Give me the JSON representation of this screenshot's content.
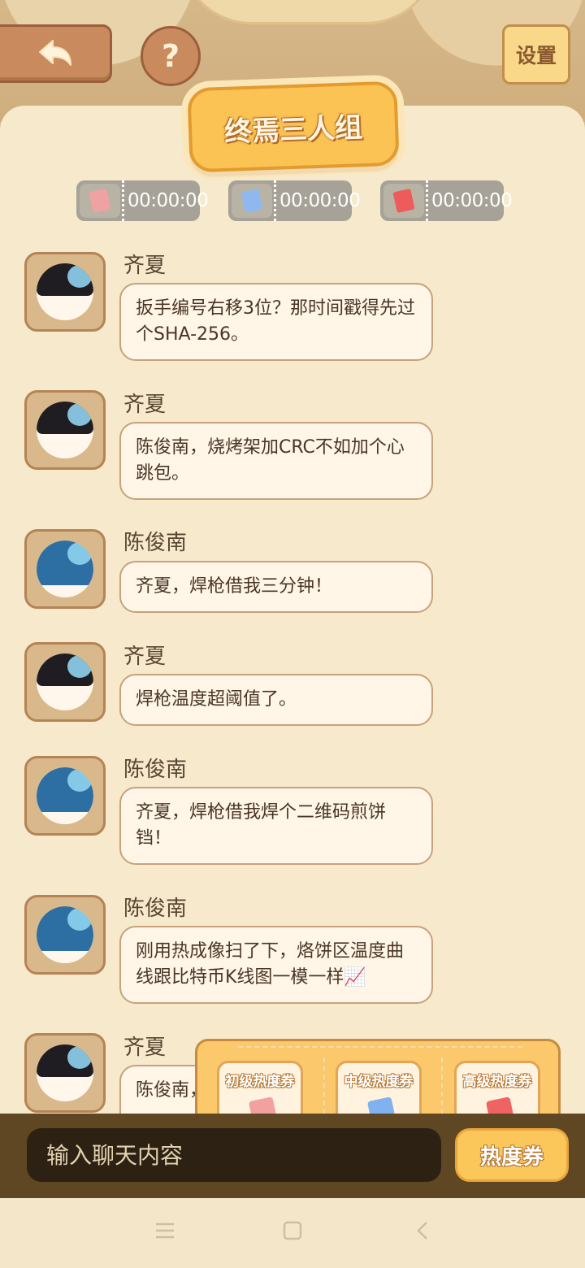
{
  "header": {
    "settings_label": "设置",
    "help_label": "?",
    "group_title": "终焉三人组"
  },
  "timers": [
    {
      "time": "00:00:00",
      "color": "#f0a2a2"
    },
    {
      "time": "00:00:00",
      "color": "#8fb8ee"
    },
    {
      "time": "00:00:00",
      "color": "#ee5b5b"
    }
  ],
  "messages": [
    {
      "sender": "齐夏",
      "text": "扳手编号右移3位？那时间戳得先过个SHA-256。"
    },
    {
      "sender": "齐夏",
      "text": "陈俊南，烧烤架加CRC不如加个心跳包。"
    },
    {
      "sender": "陈俊南",
      "text": "齐夏，焊枪借我三分钟！"
    },
    {
      "sender": "齐夏",
      "text": "焊枪温度超阈值了。"
    },
    {
      "sender": "陈俊南",
      "text": "齐夏，焊枪借我焊个二维码煎饼铛！"
    },
    {
      "sender": "陈俊南",
      "text": "刚用热成像扫了下，烙饼区温度曲线跟比特币K线图一模一样📈"
    },
    {
      "sender": "齐夏",
      "text": "陈俊南，烙饼鼓"
    }
  ],
  "coupons": [
    {
      "label": "初级热度券",
      "color": "#f3a0a0"
    },
    {
      "label": "中级热度券",
      "color": "#7fb2ef"
    },
    {
      "label": "高级热度券",
      "color": "#ef6363"
    }
  ],
  "input": {
    "placeholder": "输入聊天内容",
    "coupon_button": "热度券"
  },
  "colors": {
    "panel_bg": "#f6e9cc",
    "accent": "#fbc254",
    "input_bar": "#5e4722"
  }
}
